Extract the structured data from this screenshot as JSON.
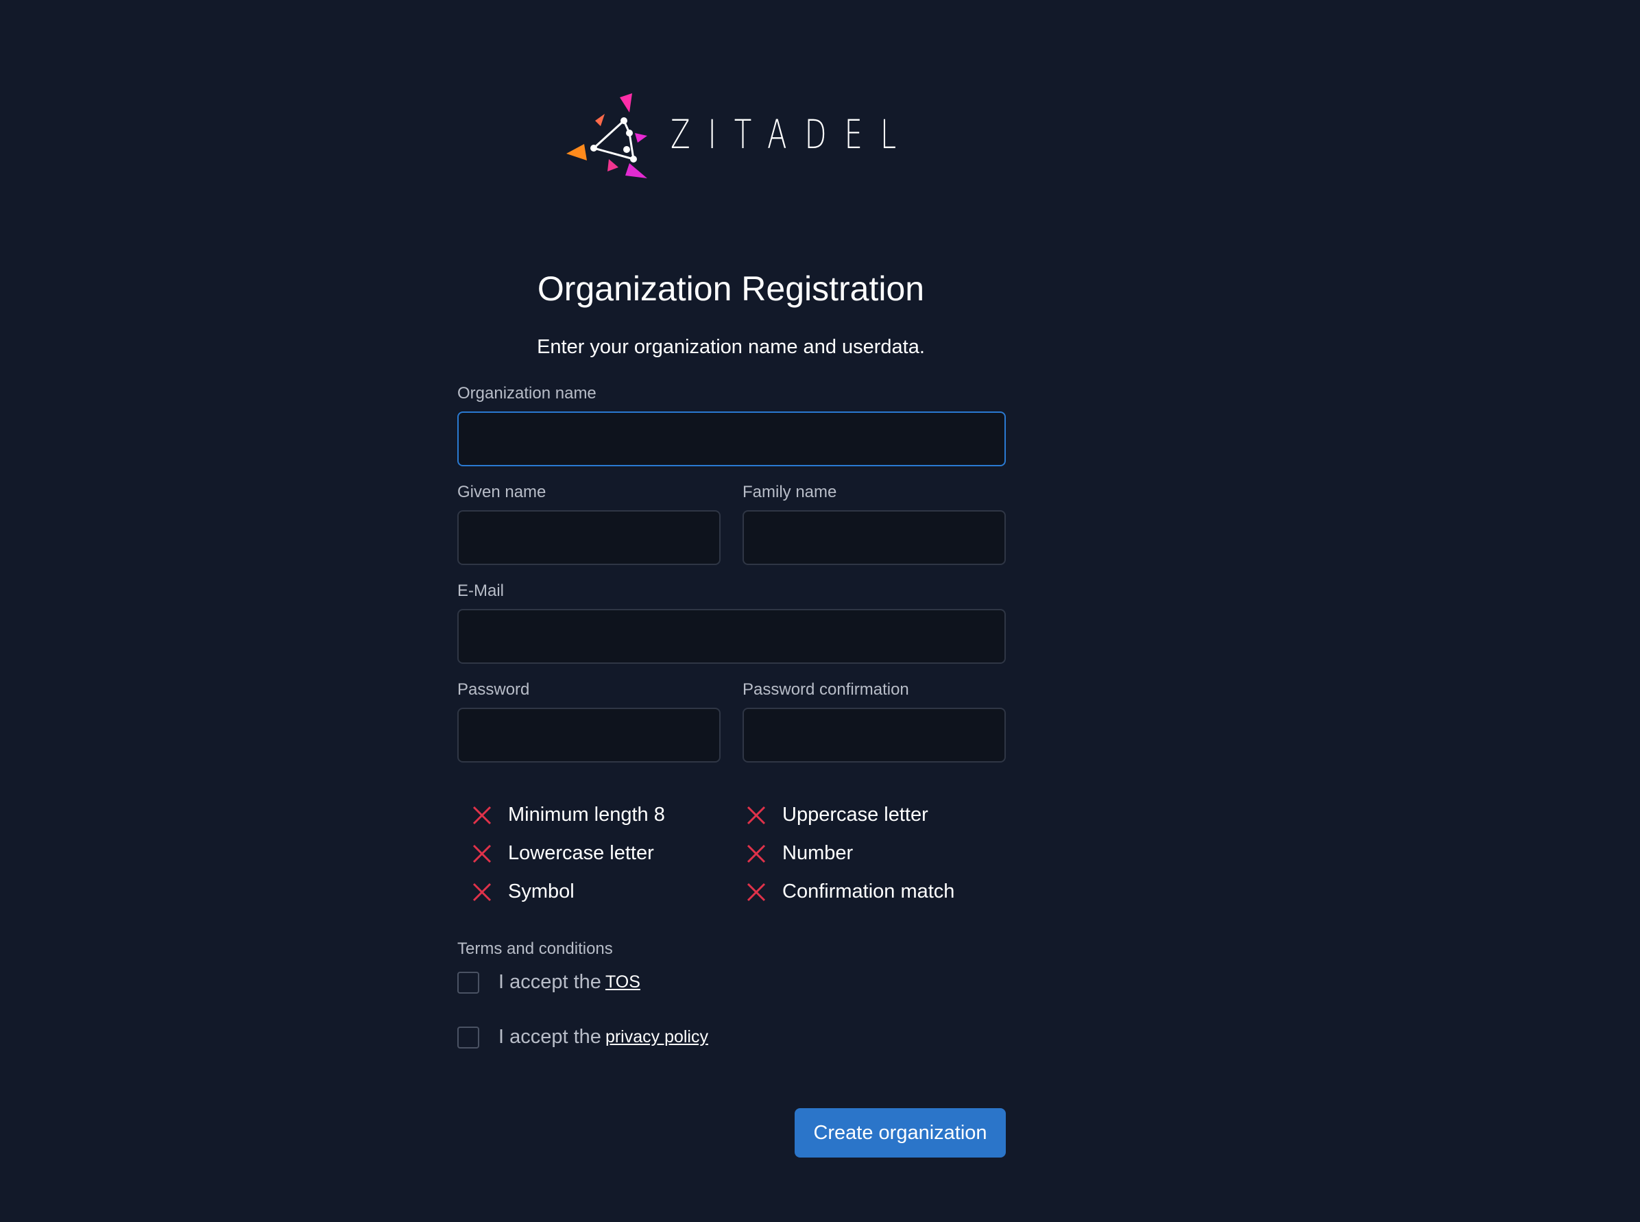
{
  "brand": {
    "name": "ZITADEL"
  },
  "header": {
    "title": "Organization Registration",
    "subtitle": "Enter your organization name and userdata."
  },
  "form": {
    "org_name_label": "Organization name",
    "org_name_value": "",
    "given_name_label": "Given name",
    "given_name_value": "",
    "family_name_label": "Family name",
    "family_name_value": "",
    "email_label": "E-Mail",
    "email_value": "",
    "password_label": "Password",
    "password_value": "",
    "password_confirmation_label": "Password confirmation",
    "password_confirmation_value": ""
  },
  "password_rules": [
    {
      "label": "Minimum length 8",
      "status": "unmet"
    },
    {
      "label": "Uppercase letter",
      "status": "unmet"
    },
    {
      "label": "Lowercase letter",
      "status": "unmet"
    },
    {
      "label": "Number",
      "status": "unmet"
    },
    {
      "label": "Symbol",
      "status": "unmet"
    },
    {
      "label": "Confirmation match",
      "status": "unmet"
    }
  ],
  "terms": {
    "section_label": "Terms and conditions",
    "tos_prefix": "I accept the",
    "tos_link": "TOS",
    "tos_checked": false,
    "privacy_prefix": "I accept the",
    "privacy_link": "privacy policy",
    "privacy_checked": false
  },
  "actions": {
    "submit_label": "Create organization"
  },
  "colors": {
    "background": "#121929",
    "input_background": "#0e131d",
    "input_border": "#2f3645",
    "focus_border": "#2a7ad2",
    "primary_button": "#2b75c9",
    "error_red": "#e0324a",
    "label_gray": "#b8bdc8"
  },
  "icons": {
    "rule_unmet": "close-x-icon"
  }
}
